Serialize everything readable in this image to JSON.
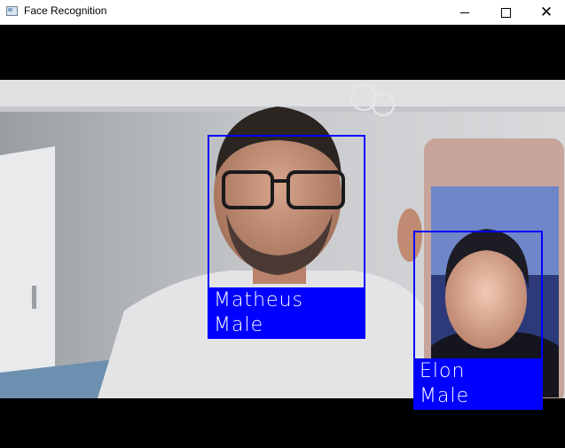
{
  "window": {
    "title": "Face Recognition",
    "icon": "opencv-window-icon"
  },
  "controls": {
    "minimize_icon": "minimize-icon",
    "maximize_icon": "maximize-icon",
    "close_icon": "close-icon",
    "close_glyph": "✕"
  },
  "detections": [
    {
      "name": "Matheus",
      "gender": "Male",
      "box_color": "#0000ff"
    },
    {
      "name": "Elon",
      "gender": "Male",
      "box_color": "#0000ff"
    }
  ]
}
